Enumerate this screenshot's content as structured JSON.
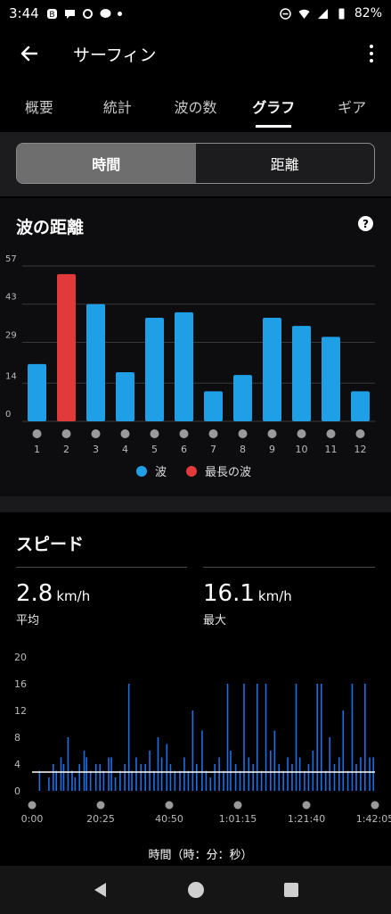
{
  "status_bar": {
    "time": "3:44",
    "battery": "82%"
  },
  "app_bar": {
    "title": "サーフィン"
  },
  "tabs": [
    {
      "label": "概要"
    },
    {
      "label": "統計"
    },
    {
      "label": "波の数"
    },
    {
      "label": "グラフ",
      "active": true
    },
    {
      "label": "ギア"
    }
  ],
  "segmented": {
    "time_label": "時間",
    "distance_label": "距離",
    "selected": "時間"
  },
  "wave_distance": {
    "title": "波の距離",
    "legend": {
      "wave": "波",
      "longest": "最長の波"
    }
  },
  "speed": {
    "title": "スピード",
    "avg_value": "2.8",
    "avg_unit": "km/h",
    "avg_label": "平均",
    "max_value": "16.1",
    "max_unit": "km/h",
    "max_label": "最大"
  },
  "colors": {
    "wave": "#1e9fe6",
    "longest": "#e23a3a",
    "speed": "#1e6fe6",
    "avg_line": "#ffffff"
  },
  "chart_data": [
    {
      "type": "bar",
      "title": "波の距離",
      "categories": [
        "1",
        "2",
        "3",
        "4",
        "5",
        "6",
        "7",
        "8",
        "9",
        "10",
        "11",
        "12"
      ],
      "values": [
        21,
        54,
        43,
        18,
        38,
        40,
        11,
        17,
        38,
        35,
        31,
        11
      ],
      "highlight_index": 1,
      "series": [
        {
          "name": "波"
        },
        {
          "name": "最長の波"
        }
      ],
      "yticks": [
        "0",
        "14",
        "29",
        "43",
        "57"
      ],
      "ylim": [
        0,
        57
      ],
      "grid": true,
      "legend": "bottom"
    },
    {
      "type": "bar",
      "title": "スピード",
      "xlabel": "時間（時：分：秒）",
      "xticks": [
        "0:00",
        "20:25",
        "40:50",
        "1:01:15",
        "1:21:40",
        "1:42:05"
      ],
      "yticks": [
        "0",
        "4",
        "8",
        "12",
        "16",
        "20"
      ],
      "ylim": [
        0,
        20
      ],
      "average": 2.8,
      "spikes": [
        [
          2.0,
          3
        ],
        [
          4.8,
          2
        ],
        [
          6.1,
          4
        ],
        [
          7.0,
          3
        ],
        [
          8.4,
          5
        ],
        [
          9.2,
          4
        ],
        [
          10.5,
          8
        ],
        [
          11.7,
          3
        ],
        [
          12.6,
          2
        ],
        [
          13.9,
          4
        ],
        [
          15.3,
          6
        ],
        [
          16.0,
          5
        ],
        [
          17.2,
          3
        ],
        [
          18.8,
          4
        ],
        [
          20.0,
          4
        ],
        [
          21.1,
          3
        ],
        [
          22.6,
          5
        ],
        [
          23.4,
          5
        ],
        [
          24.6,
          2
        ],
        [
          26.0,
          3
        ],
        [
          27.4,
          4
        ],
        [
          28.6,
          16
        ],
        [
          29.5,
          3
        ],
        [
          30.8,
          5
        ],
        [
          32.2,
          4
        ],
        [
          33.5,
          4
        ],
        [
          34.8,
          6
        ],
        [
          36.1,
          3
        ],
        [
          37.3,
          8
        ],
        [
          38.4,
          5
        ],
        [
          39.9,
          7
        ],
        [
          41.0,
          4
        ],
        [
          42.3,
          3
        ],
        [
          43.8,
          3
        ],
        [
          45.1,
          5
        ],
        [
          46.3,
          3
        ],
        [
          47.6,
          12
        ],
        [
          48.8,
          4
        ],
        [
          50.4,
          9
        ],
        [
          51.6,
          3
        ],
        [
          52.9,
          2
        ],
        [
          54.2,
          4
        ],
        [
          55.5,
          5
        ],
        [
          56.8,
          3
        ],
        [
          58.0,
          16
        ],
        [
          58.9,
          6
        ],
        [
          60.4,
          4
        ],
        [
          61.7,
          3
        ],
        [
          62.9,
          16
        ],
        [
          64.3,
          5
        ],
        [
          65.6,
          4
        ],
        [
          66.8,
          16
        ],
        [
          68.1,
          3
        ],
        [
          69.4,
          16
        ],
        [
          70.8,
          6
        ],
        [
          72.0,
          9
        ],
        [
          73.3,
          4
        ],
        [
          74.6,
          3
        ],
        [
          75.9,
          5
        ],
        [
          77.2,
          4
        ],
        [
          78.4,
          16
        ],
        [
          79.5,
          5
        ],
        [
          80.9,
          3
        ],
        [
          82.1,
          4
        ],
        [
          83.4,
          6
        ],
        [
          84.7,
          16
        ],
        [
          85.9,
          16
        ],
        [
          87.2,
          3
        ],
        [
          88.4,
          8
        ],
        [
          89.8,
          4
        ],
        [
          91.2,
          5
        ],
        [
          92.4,
          12
        ],
        [
          93.8,
          3
        ],
        [
          95.1,
          16
        ],
        [
          96.3,
          4
        ],
        [
          97.6,
          5
        ],
        [
          98.9,
          16
        ],
        [
          100.3,
          5
        ],
        [
          101.4,
          5
        ]
      ]
    }
  ]
}
